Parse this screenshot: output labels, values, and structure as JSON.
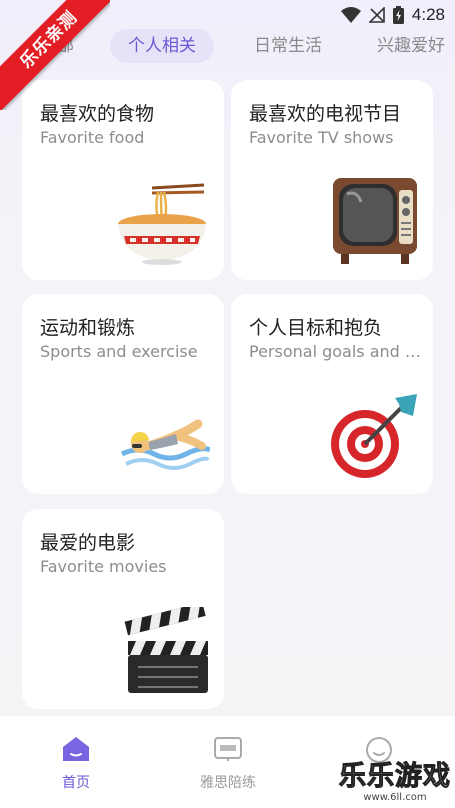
{
  "status": {
    "time": "4:28"
  },
  "ribbon": {
    "text": "乐乐亲测"
  },
  "tabs": [
    {
      "label": "全部"
    },
    {
      "label": "个人相关"
    },
    {
      "label": "日常生活"
    },
    {
      "label": "兴趣爱好"
    }
  ],
  "cards": [
    {
      "title": "最喜欢的食物",
      "subtitle": "Favorite food",
      "icon": "noodle-bowl"
    },
    {
      "title": "最喜欢的电视节目",
      "subtitle": "Favorite TV shows",
      "icon": "television"
    },
    {
      "title": "运动和锻炼",
      "subtitle": "Sports and exercise",
      "icon": "swimmer"
    },
    {
      "title": "个人目标和抱负",
      "subtitle": "Personal goals and …",
      "icon": "dart-target"
    },
    {
      "title": "最爱的电影",
      "subtitle": "Favorite movies",
      "icon": "clapperboard"
    }
  ],
  "nav": [
    {
      "label": "首页",
      "icon": "home-icon"
    },
    {
      "label": "雅思陪练",
      "icon": "ielts-book-icon"
    },
    {
      "label": "",
      "icon": "profile-icon"
    }
  ],
  "watermark": {
    "text": "乐乐游戏",
    "url": "www.6ll.com"
  },
  "colors": {
    "accent": "#6b58d6",
    "ribbon": "#e21d23"
  }
}
